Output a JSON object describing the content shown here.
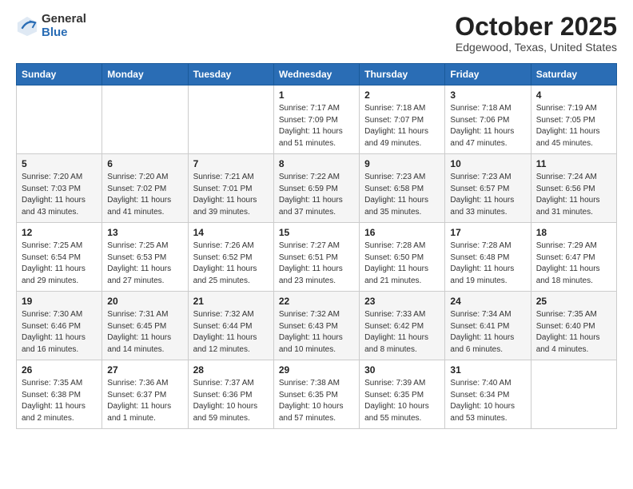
{
  "app": {
    "logo_general": "General",
    "logo_blue": "Blue",
    "title": "October 2025",
    "subtitle": "Edgewood, Texas, United States"
  },
  "calendar": {
    "headers": [
      "Sunday",
      "Monday",
      "Tuesday",
      "Wednesday",
      "Thursday",
      "Friday",
      "Saturday"
    ],
    "weeks": [
      [
        {
          "day": "",
          "info": ""
        },
        {
          "day": "",
          "info": ""
        },
        {
          "day": "",
          "info": ""
        },
        {
          "day": "1",
          "info": "Sunrise: 7:17 AM\nSunset: 7:09 PM\nDaylight: 11 hours\nand 51 minutes."
        },
        {
          "day": "2",
          "info": "Sunrise: 7:18 AM\nSunset: 7:07 PM\nDaylight: 11 hours\nand 49 minutes."
        },
        {
          "day": "3",
          "info": "Sunrise: 7:18 AM\nSunset: 7:06 PM\nDaylight: 11 hours\nand 47 minutes."
        },
        {
          "day": "4",
          "info": "Sunrise: 7:19 AM\nSunset: 7:05 PM\nDaylight: 11 hours\nand 45 minutes."
        }
      ],
      [
        {
          "day": "5",
          "info": "Sunrise: 7:20 AM\nSunset: 7:03 PM\nDaylight: 11 hours\nand 43 minutes."
        },
        {
          "day": "6",
          "info": "Sunrise: 7:20 AM\nSunset: 7:02 PM\nDaylight: 11 hours\nand 41 minutes."
        },
        {
          "day": "7",
          "info": "Sunrise: 7:21 AM\nSunset: 7:01 PM\nDaylight: 11 hours\nand 39 minutes."
        },
        {
          "day": "8",
          "info": "Sunrise: 7:22 AM\nSunset: 6:59 PM\nDaylight: 11 hours\nand 37 minutes."
        },
        {
          "day": "9",
          "info": "Sunrise: 7:23 AM\nSunset: 6:58 PM\nDaylight: 11 hours\nand 35 minutes."
        },
        {
          "day": "10",
          "info": "Sunrise: 7:23 AM\nSunset: 6:57 PM\nDaylight: 11 hours\nand 33 minutes."
        },
        {
          "day": "11",
          "info": "Sunrise: 7:24 AM\nSunset: 6:56 PM\nDaylight: 11 hours\nand 31 minutes."
        }
      ],
      [
        {
          "day": "12",
          "info": "Sunrise: 7:25 AM\nSunset: 6:54 PM\nDaylight: 11 hours\nand 29 minutes."
        },
        {
          "day": "13",
          "info": "Sunrise: 7:25 AM\nSunset: 6:53 PM\nDaylight: 11 hours\nand 27 minutes."
        },
        {
          "day": "14",
          "info": "Sunrise: 7:26 AM\nSunset: 6:52 PM\nDaylight: 11 hours\nand 25 minutes."
        },
        {
          "day": "15",
          "info": "Sunrise: 7:27 AM\nSunset: 6:51 PM\nDaylight: 11 hours\nand 23 minutes."
        },
        {
          "day": "16",
          "info": "Sunrise: 7:28 AM\nSunset: 6:50 PM\nDaylight: 11 hours\nand 21 minutes."
        },
        {
          "day": "17",
          "info": "Sunrise: 7:28 AM\nSunset: 6:48 PM\nDaylight: 11 hours\nand 19 minutes."
        },
        {
          "day": "18",
          "info": "Sunrise: 7:29 AM\nSunset: 6:47 PM\nDaylight: 11 hours\nand 18 minutes."
        }
      ],
      [
        {
          "day": "19",
          "info": "Sunrise: 7:30 AM\nSunset: 6:46 PM\nDaylight: 11 hours\nand 16 minutes."
        },
        {
          "day": "20",
          "info": "Sunrise: 7:31 AM\nSunset: 6:45 PM\nDaylight: 11 hours\nand 14 minutes."
        },
        {
          "day": "21",
          "info": "Sunrise: 7:32 AM\nSunset: 6:44 PM\nDaylight: 11 hours\nand 12 minutes."
        },
        {
          "day": "22",
          "info": "Sunrise: 7:32 AM\nSunset: 6:43 PM\nDaylight: 11 hours\nand 10 minutes."
        },
        {
          "day": "23",
          "info": "Sunrise: 7:33 AM\nSunset: 6:42 PM\nDaylight: 11 hours\nand 8 minutes."
        },
        {
          "day": "24",
          "info": "Sunrise: 7:34 AM\nSunset: 6:41 PM\nDaylight: 11 hours\nand 6 minutes."
        },
        {
          "day": "25",
          "info": "Sunrise: 7:35 AM\nSunset: 6:40 PM\nDaylight: 11 hours\nand 4 minutes."
        }
      ],
      [
        {
          "day": "26",
          "info": "Sunrise: 7:35 AM\nSunset: 6:38 PM\nDaylight: 11 hours\nand 2 minutes."
        },
        {
          "day": "27",
          "info": "Sunrise: 7:36 AM\nSunset: 6:37 PM\nDaylight: 11 hours\nand 1 minute."
        },
        {
          "day": "28",
          "info": "Sunrise: 7:37 AM\nSunset: 6:36 PM\nDaylight: 10 hours\nand 59 minutes."
        },
        {
          "day": "29",
          "info": "Sunrise: 7:38 AM\nSunset: 6:35 PM\nDaylight: 10 hours\nand 57 minutes."
        },
        {
          "day": "30",
          "info": "Sunrise: 7:39 AM\nSunset: 6:35 PM\nDaylight: 10 hours\nand 55 minutes."
        },
        {
          "day": "31",
          "info": "Sunrise: 7:40 AM\nSunset: 6:34 PM\nDaylight: 10 hours\nand 53 minutes."
        },
        {
          "day": "",
          "info": ""
        }
      ]
    ]
  }
}
